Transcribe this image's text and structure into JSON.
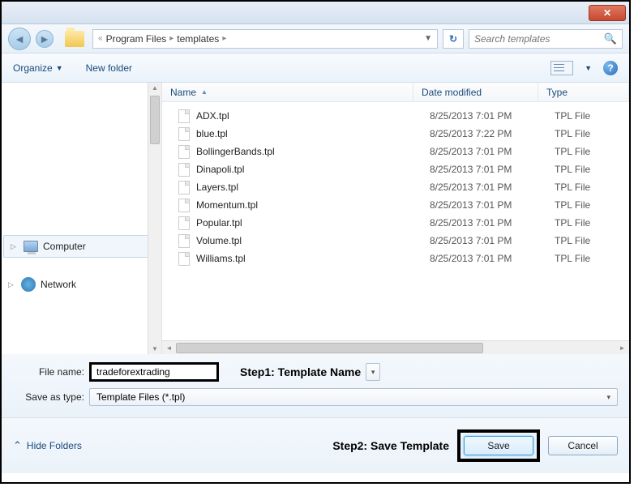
{
  "titlebar": {
    "close": "✕"
  },
  "nav": {
    "path": {
      "seg1": "Program Files",
      "seg2": "templates"
    },
    "search_placeholder": "Search templates"
  },
  "toolbar": {
    "organize": "Organize",
    "new_folder": "New folder"
  },
  "tree": {
    "computer": "Computer",
    "network": "Network"
  },
  "columns": {
    "name": "Name",
    "date": "Date modified",
    "type": "Type"
  },
  "files": [
    {
      "name": "ADX.tpl",
      "date": "8/25/2013 7:01 PM",
      "type": "TPL File"
    },
    {
      "name": "blue.tpl",
      "date": "8/25/2013 7:22 PM",
      "type": "TPL File"
    },
    {
      "name": "BollingerBands.tpl",
      "date": "8/25/2013 7:01 PM",
      "type": "TPL File"
    },
    {
      "name": "Dinapoli.tpl",
      "date": "8/25/2013 7:01 PM",
      "type": "TPL File"
    },
    {
      "name": "Layers.tpl",
      "date": "8/25/2013 7:01 PM",
      "type": "TPL File"
    },
    {
      "name": "Momentum.tpl",
      "date": "8/25/2013 7:01 PM",
      "type": "TPL File"
    },
    {
      "name": "Popular.tpl",
      "date": "8/25/2013 7:01 PM",
      "type": "TPL File"
    },
    {
      "name": "Volume.tpl",
      "date": "8/25/2013 7:01 PM",
      "type": "TPL File"
    },
    {
      "name": "Williams.tpl",
      "date": "8/25/2013 7:01 PM",
      "type": "TPL File"
    }
  ],
  "form": {
    "filename_label": "File name:",
    "filename_value": "tradeforextrading",
    "saveas_label": "Save as type:",
    "saveas_value": "Template Files (*.tpl)"
  },
  "annotations": {
    "step1": "Step1: Template Name",
    "step2": "Step2: Save Template"
  },
  "buttons": {
    "hide_folders": "Hide Folders",
    "save": "Save",
    "cancel": "Cancel"
  }
}
